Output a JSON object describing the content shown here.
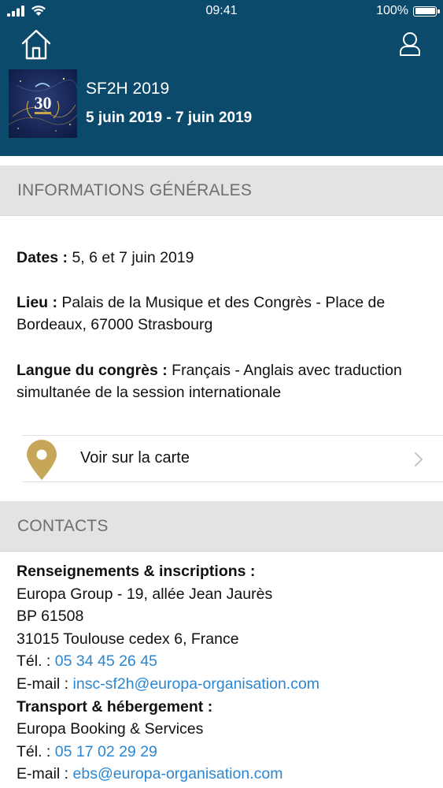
{
  "status_bar": {
    "time": "09:41",
    "battery": "100%",
    "battery_level": 1.0
  },
  "header": {
    "home_icon": "home-icon",
    "user_icon": "user-icon",
    "thumbnail_text": "30",
    "event_title": "SF2H 2019",
    "event_dates": "5 juin 2019 - 7 juin 2019"
  },
  "colors": {
    "header_bg": "#0c4a6b",
    "section_bg": "#e3e3e3",
    "link": "#2a86d1",
    "pin": "#c6a658"
  },
  "sections": {
    "general_title": "INFORMATIONS GÉNÉRALES",
    "contacts_title": "CONTACTS"
  },
  "general": {
    "dates_label": "Dates :",
    "dates_value": " 5, 6 et 7 juin 2019",
    "lieu_label": "Lieu :",
    "lieu_value": " Palais de la Musique et des Congrès - Place de Bordeaux, 67000 Strasbourg",
    "langue_label": "Langue du congrès :",
    "langue_value": " Français - Anglais avec traduction simultanée de la session internationale",
    "map_link": "Voir sur la carte"
  },
  "contacts": {
    "reg_title": "Renseignements & inscriptions :",
    "reg_line1": "Europa Group - 19, allée Jean Jaurès",
    "reg_line2": "BP 61508",
    "reg_line3": "31015 Toulouse cedex 6, France",
    "reg_tel_label": "Tél. : ",
    "reg_tel": "05 34 45 26 45",
    "reg_email_label": "E-mail : ",
    "reg_email": "insc-sf2h@europa-organisation.com",
    "transport_title": "Transport & hébergement :",
    "transport_line1": "Europa Booking & Services",
    "transport_tel_label": "Tél. : ",
    "transport_tel": "05 17 02 29 29",
    "transport_email_label": "E-mail : ",
    "transport_email": "ebs@europa-organisation.com"
  }
}
